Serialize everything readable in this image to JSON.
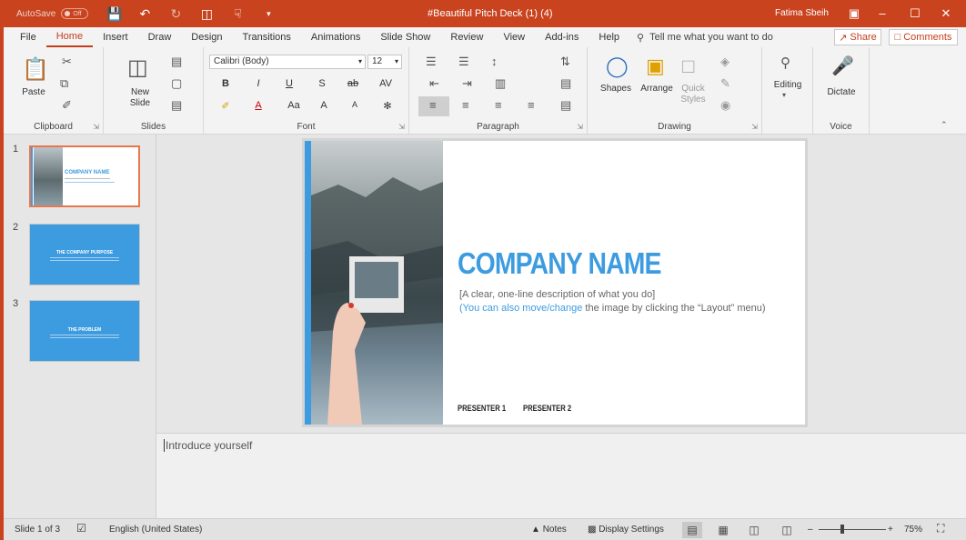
{
  "titlebar": {
    "autosave_label": "AutoSave",
    "autosave_state": "Off",
    "doc_title": "#Beautiful Pitch Deck (1) (4)",
    "user": "Fatima Sbeih",
    "accent_color": "#c9431f"
  },
  "tabs": [
    "File",
    "Home",
    "Insert",
    "Draw",
    "Design",
    "Transitions",
    "Animations",
    "Slide Show",
    "Review",
    "View",
    "Add-ins",
    "Help"
  ],
  "active_tab": "Home",
  "tell_me": "Tell me what you want to do",
  "share_label": "Share",
  "comments_label": "Comments",
  "ribbon": {
    "clipboard": {
      "label": "Clipboard",
      "paste": "Paste"
    },
    "slides": {
      "label": "Slides",
      "new_slide": "New",
      "new_slide2": "Slide"
    },
    "font": {
      "label": "Font",
      "family": "Calibri (Body)",
      "size": "12",
      "bold": "B",
      "italic": "I",
      "underline": "U",
      "shadow": "S",
      "strike": "ab",
      "spacing": "AV",
      "case": "Aa",
      "grow": "A",
      "shrink": "A"
    },
    "paragraph": {
      "label": "Paragraph"
    },
    "drawing": {
      "label": "Drawing",
      "shapes": "Shapes",
      "arrange": "Arrange",
      "quick_styles": "Quick",
      "quick_styles2": "Styles"
    },
    "editing": {
      "label": "Editing"
    },
    "voice": {
      "label": "Voice",
      "dictate": "Dictate"
    }
  },
  "thumbnails": [
    {
      "number": "1",
      "title": "COMPANY NAME",
      "selected": true
    },
    {
      "number": "2",
      "title": "THE COMPANY PURPOSE",
      "selected": false
    },
    {
      "number": "3",
      "title": "THE PROBLEM",
      "selected": false
    }
  ],
  "slide": {
    "company": "COMPANY NAME",
    "desc1": "[A clear, one-line description of what you do]",
    "desc2_blue": "(You can also move/change",
    "desc2_rest": " the image by clicking the “Layout” menu)",
    "presenter1": "PRESENTER 1",
    "presenter2": "PRESENTER 2",
    "accent_color": "#3d9be0"
  },
  "notes_placeholder": "Introduce yourself",
  "status": {
    "slide_count": "Slide 1 of 3",
    "language": "English (United States)",
    "notes": "Notes",
    "display_settings": "Display Settings",
    "zoom": "75%"
  }
}
